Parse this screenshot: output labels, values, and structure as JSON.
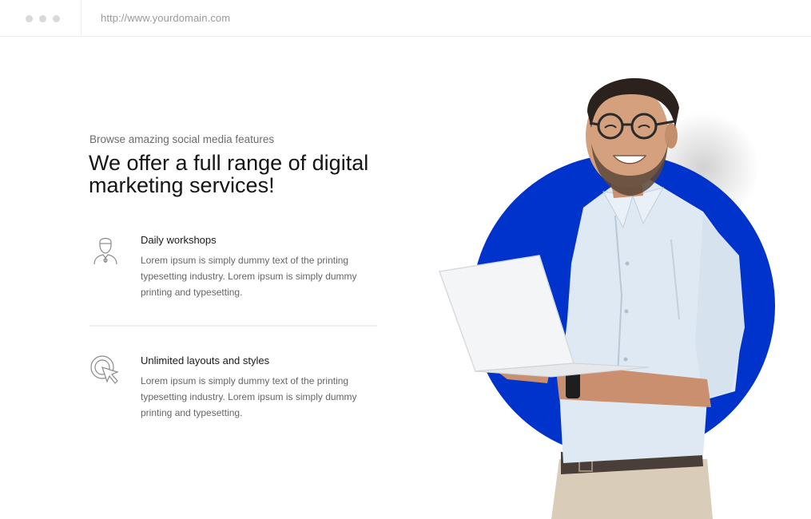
{
  "browser": {
    "url": "http://www.yourdomain.com"
  },
  "hero": {
    "eyebrow": "Browse amazing social media features",
    "headline": "We offer a full range of digital marketing services!"
  },
  "features": [
    {
      "icon": "user-icon",
      "title": "Daily workshops",
      "text": "Lorem ipsum is simply dummy text of the printing typesetting industry. Lorem ipsum is simply dummy printing and typesetting."
    },
    {
      "icon": "cursor-click-icon",
      "title": "Unlimited layouts and styles",
      "text": "Lorem ipsum is simply dummy text of the printing typesetting industry. Lorem ipsum is simply dummy printing and typesetting."
    }
  ],
  "colors": {
    "accent_blue": "#0033cc",
    "text_dark": "#151515",
    "text_muted": "#666666"
  }
}
